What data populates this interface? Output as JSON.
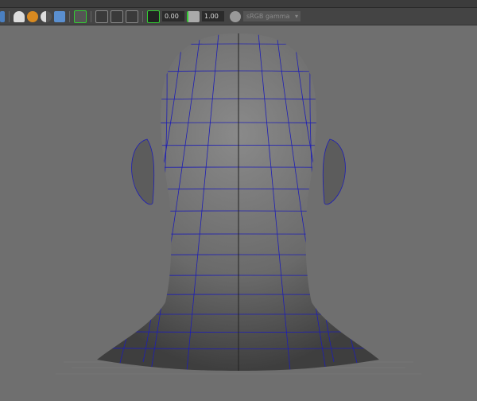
{
  "toolbar": {
    "exposure_value": "0.00",
    "gamma_value": "1.00",
    "color_space": "sRGB gamma",
    "icons": [
      "light-icon",
      "shadow-icon",
      "ambient-occlusion-icon",
      "antialias-icon",
      "isolate-icon",
      "xray-icon",
      "wireframe-shaded-icon",
      "joints-icon",
      "exposure-icon",
      "gamma-icon",
      "color-management-icon"
    ]
  },
  "colors": {
    "viewport": "#6f6f6f",
    "wireframe": "#1e1eb4",
    "mesh": "#6a6a6a"
  }
}
